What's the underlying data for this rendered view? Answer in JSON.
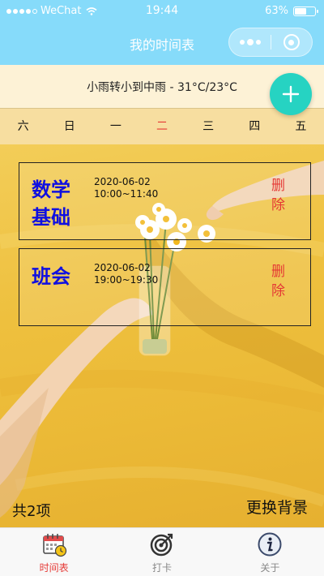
{
  "status": {
    "carrier": "WeChat",
    "time": "19:44",
    "battery_text": "63%",
    "battery_level": 0.63
  },
  "nav": {
    "title": "我的时间表"
  },
  "weather": {
    "text": "小雨转小到中雨 - 31°C/23°C"
  },
  "week": {
    "days": [
      "六",
      "日",
      "一",
      "二",
      "三",
      "四",
      "五"
    ],
    "today_index": 3,
    "today_color": "#e53935"
  },
  "courses": [
    {
      "name": "数学基础",
      "date": "2020-06-02",
      "time": "10:00~11:40",
      "delete_label": "删除"
    },
    {
      "name": "班会",
      "date": "2020-06-02",
      "time": "19:00~19:30",
      "delete_label": "删除"
    }
  ],
  "footer": {
    "count": "共2项",
    "change_bg": "更换背景"
  },
  "tabs": [
    {
      "label": "时间表",
      "icon": "calendar-clock-icon",
      "active": true
    },
    {
      "label": "打卡",
      "icon": "target-check-icon",
      "active": false
    },
    {
      "label": "关于",
      "icon": "info-icon",
      "active": false
    }
  ],
  "colors": {
    "nav_bg": "#86dbfa",
    "add_button": "#26d3c2",
    "course_name": "#1010e0",
    "delete": "#e53935",
    "background": "#f2c43c"
  }
}
